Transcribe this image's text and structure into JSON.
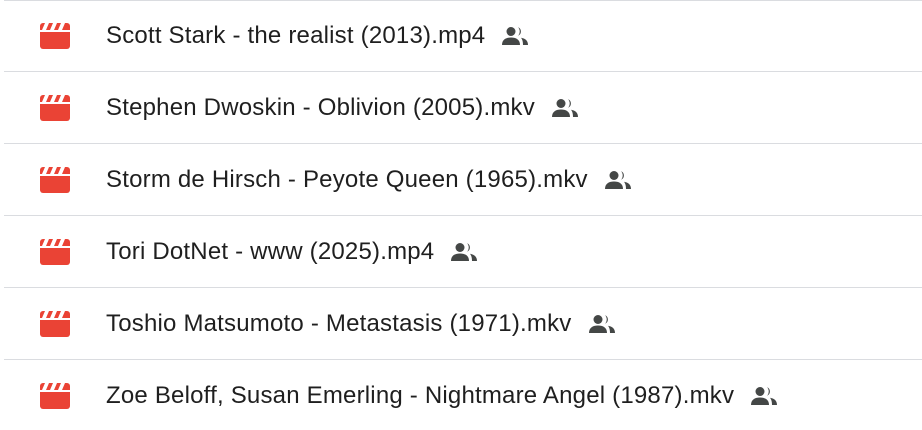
{
  "colors": {
    "video_icon": "#ea4335",
    "shared_icon": "#444746",
    "divider": "#dadce0",
    "text": "#1f1f1f"
  },
  "files": [
    {
      "name": "Scott Stark - the realist (2013).mp4",
      "type_icon": "video-file-icon",
      "shared_icon": "shared-people-icon"
    },
    {
      "name": "Stephen Dwoskin - Oblivion (2005).mkv",
      "type_icon": "video-file-icon",
      "shared_icon": "shared-people-icon"
    },
    {
      "name": "Storm de Hirsch - Peyote Queen (1965).mkv",
      "type_icon": "video-file-icon",
      "shared_icon": "shared-people-icon"
    },
    {
      "name": "Tori DotNet - www (2025).mp4",
      "type_icon": "video-file-icon",
      "shared_icon": "shared-people-icon"
    },
    {
      "name": "Toshio Matsumoto - Metastasis (1971).mkv",
      "type_icon": "video-file-icon",
      "shared_icon": "shared-people-icon"
    },
    {
      "name": "Zoe Beloff, Susan Emerling - Nightmare Angel (1987).mkv",
      "type_icon": "video-file-icon",
      "shared_icon": "shared-people-icon"
    }
  ]
}
